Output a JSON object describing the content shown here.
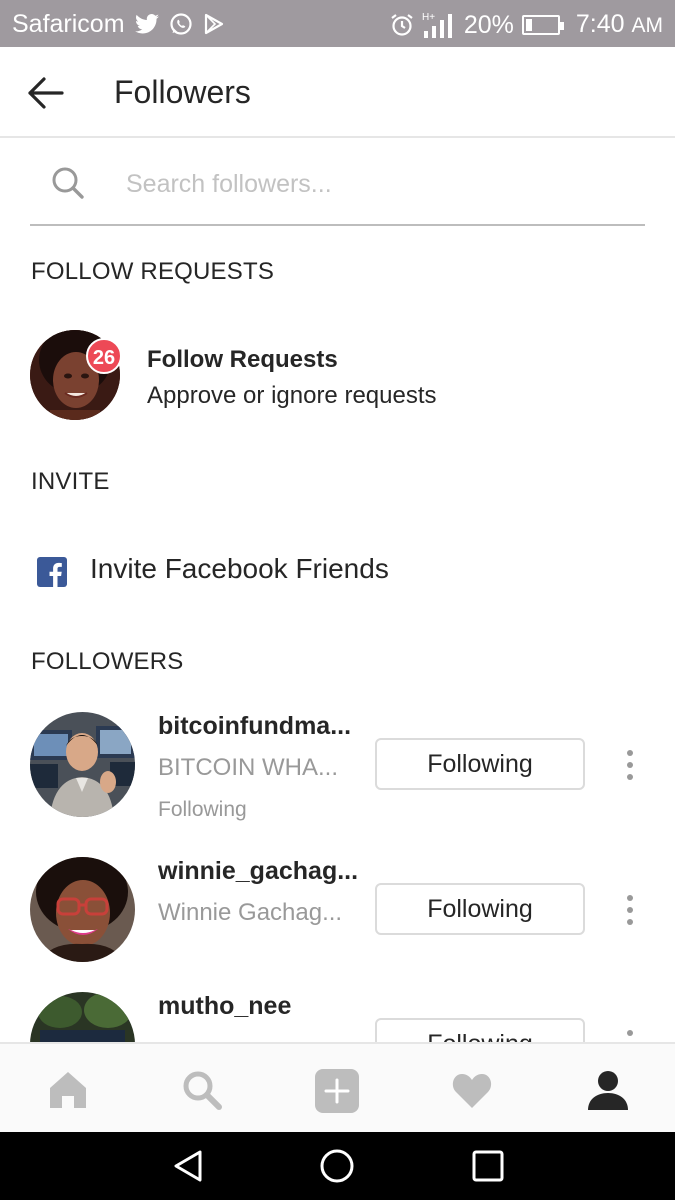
{
  "status_bar": {
    "carrier": "Safaricom",
    "network": "H+",
    "battery": "20%",
    "battery_level": 0.2,
    "time": "7:40",
    "ampm": "AM"
  },
  "header": {
    "title": "Followers"
  },
  "search": {
    "placeholder": "Search followers..."
  },
  "sections": {
    "follow_requests": "FOLLOW REQUESTS",
    "invite": "INVITE",
    "followers": "FOLLOWERS"
  },
  "follow_requests": {
    "badge": "26",
    "title": "Follow Requests",
    "subtitle": "Approve or ignore requests"
  },
  "invite": {
    "label": "Invite Facebook Friends"
  },
  "followers": [
    {
      "username": "bitcoinfundma...",
      "name": "BITCOIN WHA...",
      "status": "Following",
      "button": "Following"
    },
    {
      "username": "winnie_gachag...",
      "name": "Winnie Gachag...",
      "status": "",
      "button": "Following"
    },
    {
      "username": "mutho_nee",
      "name": "",
      "status": "",
      "button": "Following"
    }
  ],
  "colors": {
    "badge": "#ed4956",
    "facebook": "#3b5998",
    "status_bar": "#9f9a9f"
  }
}
